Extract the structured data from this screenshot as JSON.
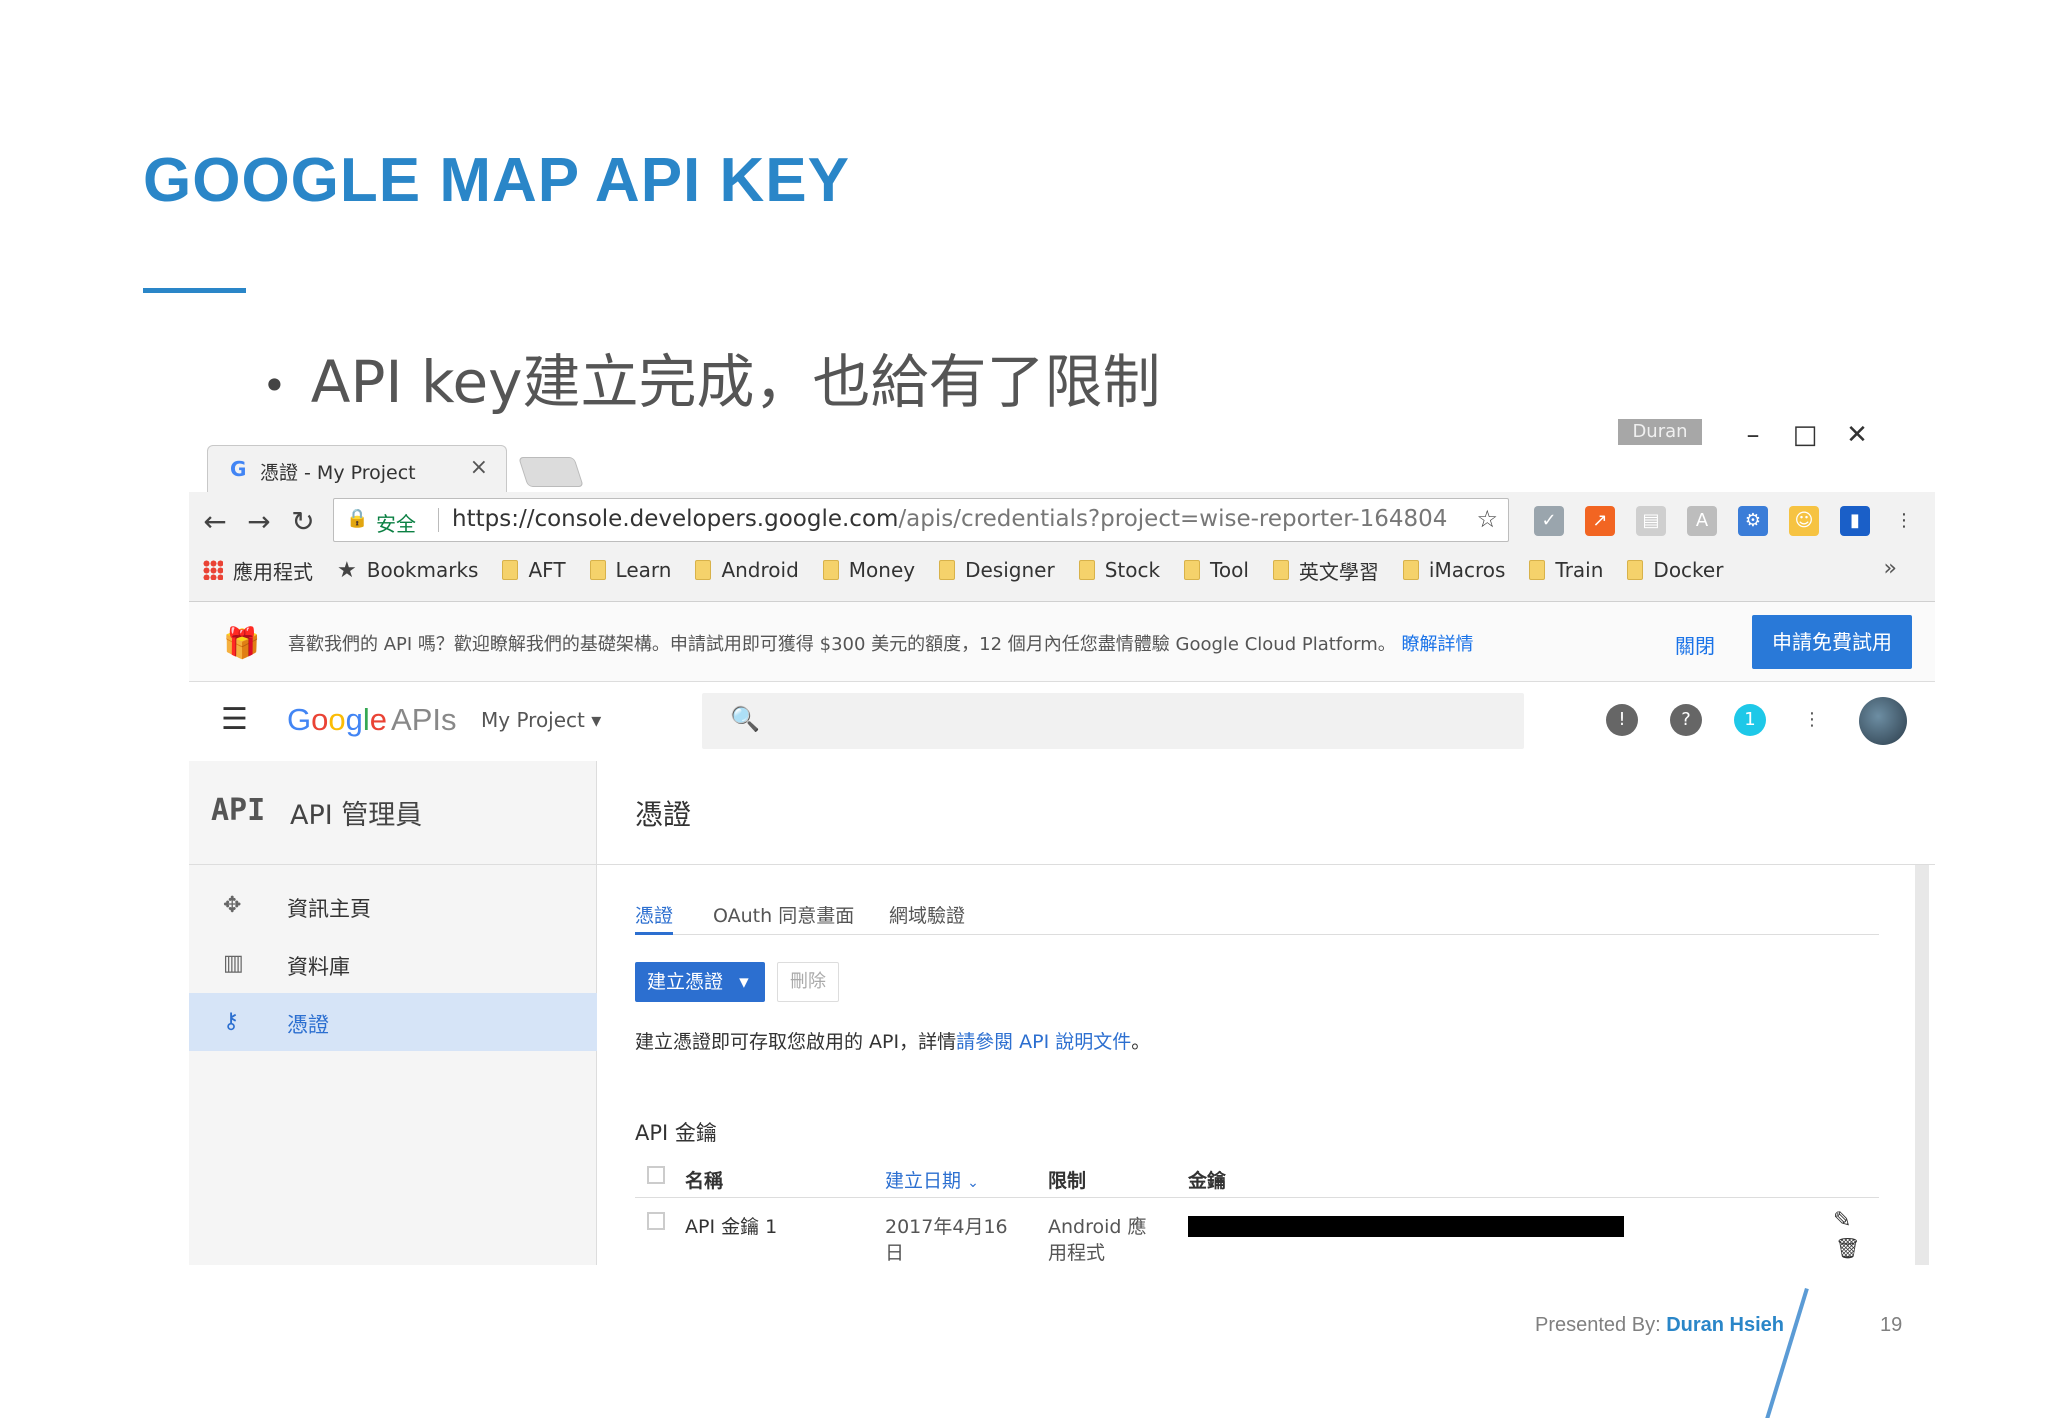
{
  "slide": {
    "title": "GOOGLE MAP API KEY",
    "bullet": "API key建立完成，也給有了限制",
    "footer_prefix": "Presented By:",
    "footer_name": "Duran Hsieh",
    "page_number": "19"
  },
  "window": {
    "user": "Duran",
    "tab_title": "憑證 - My Project",
    "secure_label": "安全",
    "url_main": "https://console.developers.google.com",
    "url_path": "/apis/credentials?project=wise-reporter-164804"
  },
  "bookmarks": [
    {
      "label": "應用程式",
      "icon": "apps-icon"
    },
    {
      "label": "Bookmarks",
      "icon": "star-icon"
    },
    {
      "label": "AFT",
      "icon": "folder-icon"
    },
    {
      "label": "Learn",
      "icon": "folder-icon"
    },
    {
      "label": "Android",
      "icon": "folder-icon"
    },
    {
      "label": "Money",
      "icon": "folder-icon"
    },
    {
      "label": "Designer",
      "icon": "folder-icon"
    },
    {
      "label": "Stock",
      "icon": "folder-icon"
    },
    {
      "label": "Tool",
      "icon": "folder-icon"
    },
    {
      "label": "英文學習",
      "icon": "folder-icon"
    },
    {
      "label": "iMacros",
      "icon": "folder-icon"
    },
    {
      "label": "Train",
      "icon": "folder-icon"
    },
    {
      "label": "Docker",
      "icon": "folder-icon"
    }
  ],
  "promo": {
    "message": "喜歡我們的 API 嗎？歡迎瞭解我們的基礎架構。申請試用即可獲得 $300 美元的額度，12 個月內任您盡情體驗 Google Cloud Platform。",
    "learn_more": "瞭解詳情",
    "close": "關閉",
    "trial_button": "申請免費試用"
  },
  "gbar": {
    "logo_google": "Google",
    "logo_apis": "APIs",
    "project": "My Project",
    "notification_count": "1"
  },
  "sidebar": {
    "badge": "API",
    "title": "API 管理員",
    "items": [
      {
        "label": "資訊主頁",
        "icon": "dashboard-icon",
        "active": false
      },
      {
        "label": "資料庫",
        "icon": "library-icon",
        "active": false
      },
      {
        "label": "憑證",
        "icon": "key-icon",
        "active": true
      }
    ]
  },
  "main": {
    "page_title": "憑證",
    "tabs": [
      "憑證",
      "OAuth 同意畫面",
      "網域驗證"
    ],
    "create_button": "建立憑證",
    "delete_button": "刪除",
    "info_text": "建立憑證即可存取您啟用的 API，詳情",
    "info_link": "請參閱 API 說明文件",
    "info_end": "。",
    "section_title": "API 金鑰",
    "columns": [
      "名稱",
      "建立日期",
      "限制",
      "金鑰"
    ],
    "rows": [
      {
        "name": "API 金鑰 1",
        "date_line1": "2017年4月16",
        "date_line2": "日",
        "restriction_line1": "Android 應",
        "restriction_line2": "用程式"
      }
    ]
  },
  "colors": {
    "accent": "#2a86c8",
    "primary_button": "#2c6fd0"
  }
}
